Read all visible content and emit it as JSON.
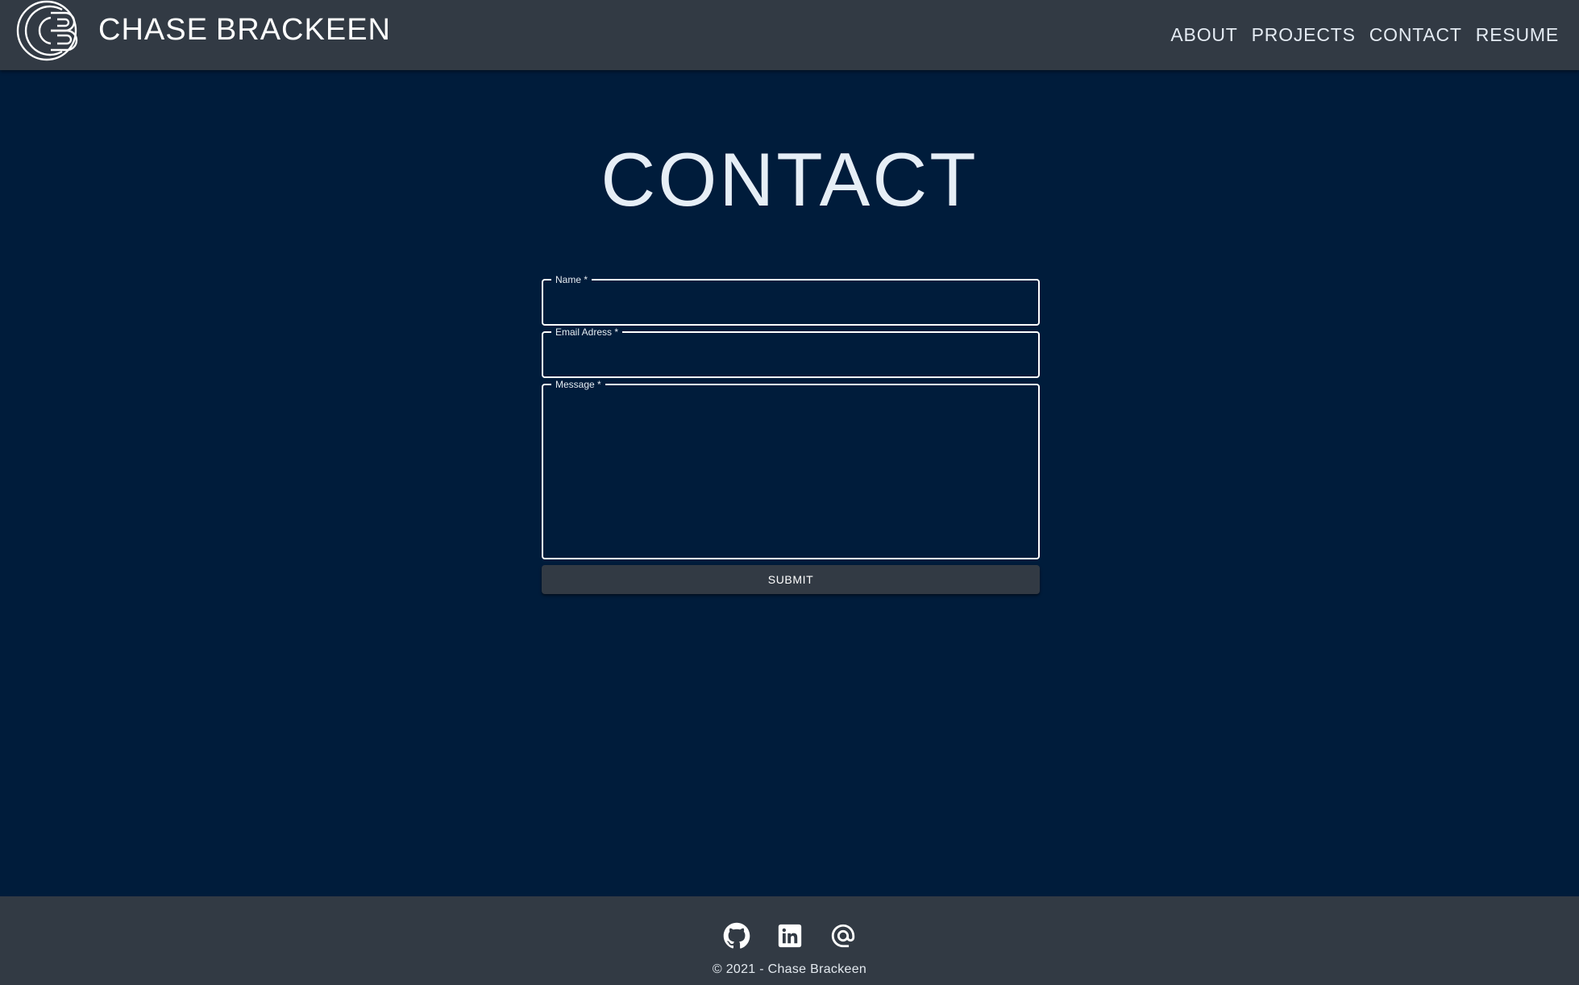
{
  "brand": {
    "first": "CHASE",
    "last": "BRACKEEN"
  },
  "nav": {
    "items": [
      {
        "label": "ABOUT"
      },
      {
        "label": "PROJECTS"
      },
      {
        "label": "CONTACT"
      },
      {
        "label": "RESUME"
      }
    ]
  },
  "main": {
    "title": "CONTACT"
  },
  "form": {
    "name_label": "Name *",
    "name_value": "",
    "email_label": "Email Adress *",
    "email_value": "",
    "message_label": "Message *",
    "message_value": "",
    "submit_label": "SUBMIT"
  },
  "footer": {
    "icons": [
      "github-icon",
      "linkedin-icon",
      "email-at-icon"
    ],
    "copyright": "© 2021 - Chase Brackeen"
  },
  "colors": {
    "background": "#001c3b",
    "header": "#323a44",
    "footer": "#323a44",
    "text": "#e6eef6"
  }
}
